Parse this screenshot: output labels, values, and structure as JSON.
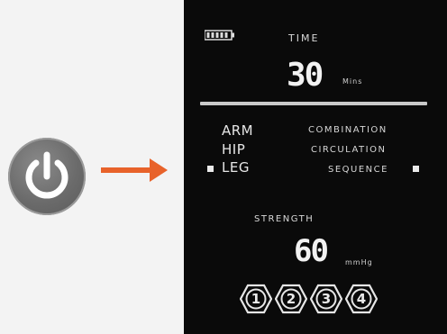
{
  "power": {
    "icon": "power-icon"
  },
  "arrow": {
    "icon": "arrow-right-icon",
    "color": "#e8622a"
  },
  "display": {
    "battery": {
      "icon": "battery-icon"
    },
    "time_label": "TIME",
    "time_value": "30",
    "time_unit": "Mins",
    "modes_left": [
      "ARM",
      "HIP",
      "LEG"
    ],
    "modes_right": [
      "COMBINATION",
      "CIRCULATION",
      "SEQUENCE"
    ],
    "selected_left": "LEG",
    "selected_right": "SEQUENCE",
    "strength_label": "STRENGTH",
    "strength_value": "60",
    "strength_unit": "mmHg",
    "levels": [
      "1",
      "2",
      "3",
      "4"
    ]
  }
}
